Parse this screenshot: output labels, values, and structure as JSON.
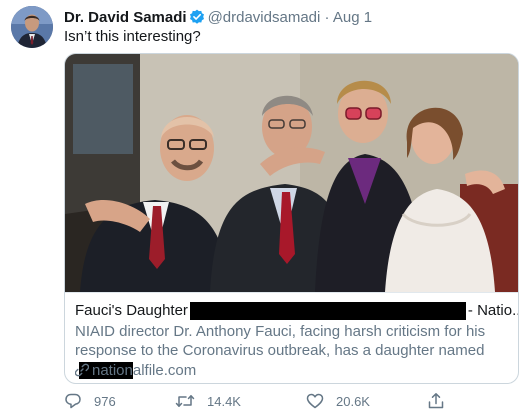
{
  "author": {
    "name": "Dr. David Samadi",
    "handle": "@drdavidsamadi",
    "separator": "·",
    "date": "Aug 1",
    "verified": true
  },
  "tweet": {
    "text": "Isn’t this interesting?"
  },
  "card": {
    "title_start": "Fauci's Daughter",
    "title_end": "- Natio...",
    "description": "NIAID director Dr. Anthony Fauci, facing harsh criticism for his response to the Coronavirus outbreak, has a daughter named",
    "domain": "nationalfile.com"
  },
  "actions": {
    "reply_count": "976",
    "retweet_count": "14.4K",
    "like_count": "20.6K"
  },
  "colors": {
    "text": "#14171a",
    "secondary": "#657786",
    "verified": "#1da1f2",
    "border": "#ccd6dd"
  },
  "icons": [
    "verified-badge-icon",
    "link-icon",
    "reply-icon",
    "retweet-icon",
    "like-icon",
    "share-icon"
  ]
}
